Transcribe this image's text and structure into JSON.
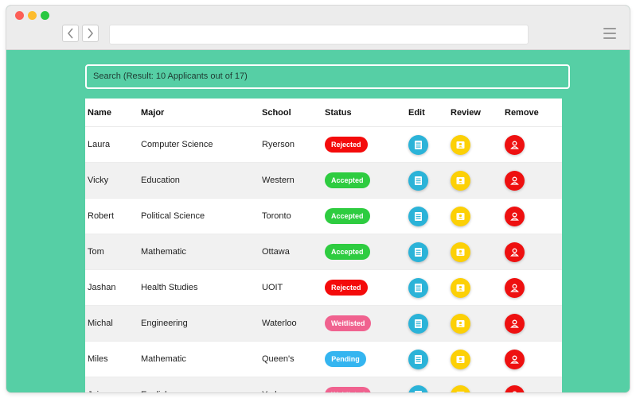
{
  "colors": {
    "page_bg": "#56cfa5",
    "rejected": "#f40b0b",
    "accepted": "#2ecc40",
    "weitlisted": "#f0628f",
    "pending": "#34b5f0",
    "edit": "#2bb3d8",
    "review": "#fcd006",
    "remove": "#ee1010"
  },
  "search": {
    "label": "Search (Result: 10 Applicants out of 17)"
  },
  "table": {
    "headers": {
      "name": "Name",
      "major": "Major",
      "school": "School",
      "status": "Status",
      "edit": "Edit",
      "review": "Review",
      "remove": "Remove"
    },
    "rows": [
      {
        "name": "Laura",
        "major": "Computer Science",
        "school": "Ryerson",
        "status": "Rejected",
        "status_color": "#f40b0b"
      },
      {
        "name": "Vicky",
        "major": "Education",
        "school": "Western",
        "status": "Accepted",
        "status_color": "#2ecc40"
      },
      {
        "name": "Robert",
        "major": "Political Science",
        "school": "Toronto",
        "status": "Accepted",
        "status_color": "#2ecc40"
      },
      {
        "name": "Tom",
        "major": "Mathematic",
        "school": "Ottawa",
        "status": "Accepted",
        "status_color": "#2ecc40"
      },
      {
        "name": "Jashan",
        "major": "Health Studies",
        "school": "UOIT",
        "status": "Rejected",
        "status_color": "#f40b0b"
      },
      {
        "name": "Michal",
        "major": "Engineering",
        "school": "Waterloo",
        "status": "Weitlisted",
        "status_color": "#f0628f"
      },
      {
        "name": "Miles",
        "major": "Mathematic",
        "school": "Queen's",
        "status": "Pending",
        "status_color": "#34b5f0"
      },
      {
        "name": "Jojo",
        "major": "English",
        "school": "York",
        "status": "Weitlisted",
        "status_color": "#f0628f"
      }
    ]
  },
  "icons": {
    "back": "chevron-left-icon",
    "forward": "chevron-right-icon",
    "menu": "hamburger-menu-icon",
    "edit": "document-icon",
    "review": "id-card-icon",
    "remove": "user-icon"
  }
}
